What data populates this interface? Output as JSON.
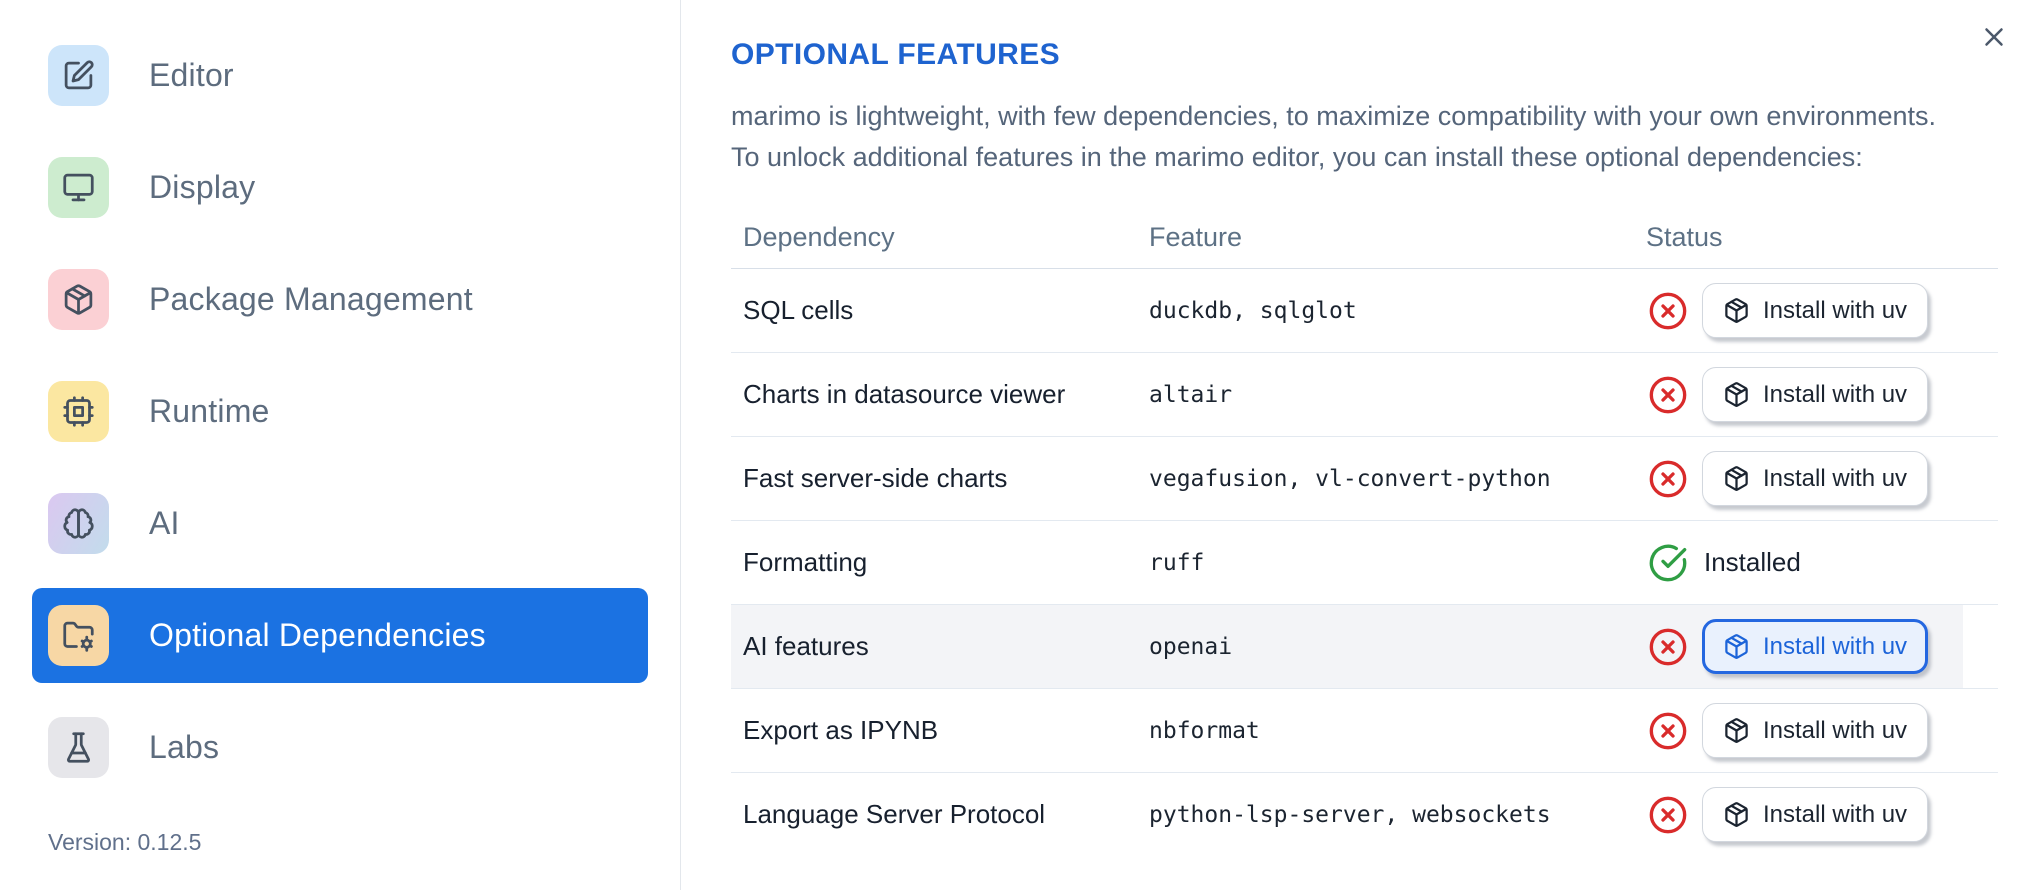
{
  "sidebar": {
    "items": [
      {
        "id": "editor",
        "label": "Editor",
        "icon": "square-pen-icon",
        "tile_color": "#cde5fa",
        "selected": false
      },
      {
        "id": "display",
        "label": "Display",
        "icon": "monitor-icon",
        "tile_color": "#cdeccf",
        "selected": false
      },
      {
        "id": "package-management",
        "label": "Package Management",
        "icon": "package-icon",
        "tile_color": "#fbd0d4",
        "selected": false
      },
      {
        "id": "runtime",
        "label": "Runtime",
        "icon": "cpu-icon",
        "tile_color": "#fbe7a1",
        "selected": false
      },
      {
        "id": "ai",
        "label": "AI",
        "icon": "brain-icon",
        "tile_color": "linear-gradient(120deg,#dbc8f0 0%,#c2dcec 100%)",
        "selected": false
      },
      {
        "id": "optional-dependencies",
        "label": "Optional Dependencies",
        "icon": "folder-cog-icon",
        "tile_color": "#f7d7a5",
        "selected": true
      },
      {
        "id": "labs",
        "label": "Labs",
        "icon": "flask-icon",
        "tile_color": "#e6e6ea",
        "selected": false
      }
    ],
    "version_label": "Version: 0.12.5",
    "selected_color": "#1b72e2"
  },
  "main": {
    "title": "OPTIONAL FEATURES",
    "title_color": "#1e63cf",
    "description_line1": "marimo is lightweight, with few dependencies, to maximize compatibility with your own environments.",
    "description_line2": "To unlock additional features in the marimo editor, you can install these optional dependencies:",
    "table": {
      "columns": [
        "Dependency",
        "Feature",
        "Status"
      ],
      "install_button_label": "Install with uv",
      "installed_label": "Installed",
      "status_colors": {
        "missing": "#d92b2b",
        "installed": "#2f9e44"
      },
      "rows": [
        {
          "dependency": "SQL cells",
          "feature": "duckdb, sqlglot",
          "status": "missing",
          "action": "Install with uv",
          "highlighted": false,
          "focused": false
        },
        {
          "dependency": "Charts in datasource viewer",
          "feature": "altair",
          "status": "missing",
          "action": "Install with uv",
          "highlighted": false,
          "focused": false
        },
        {
          "dependency": "Fast server-side charts",
          "feature": "vegafusion, vl-convert-python",
          "status": "missing",
          "action": "Install with uv",
          "highlighted": false,
          "focused": false
        },
        {
          "dependency": "Formatting",
          "feature": "ruff",
          "status": "installed",
          "status_label": "Installed",
          "highlighted": false,
          "focused": false
        },
        {
          "dependency": "AI features",
          "feature": "openai",
          "status": "missing",
          "action": "Install with uv",
          "highlighted": true,
          "focused": true
        },
        {
          "dependency": "Export as IPYNB",
          "feature": "nbformat",
          "status": "missing",
          "action": "Install with uv",
          "highlighted": false,
          "focused": false
        },
        {
          "dependency": "Language Server Protocol",
          "feature": "python-lsp-server, websockets",
          "status": "missing",
          "action": "Install with uv",
          "highlighted": false,
          "focused": false
        }
      ]
    }
  }
}
